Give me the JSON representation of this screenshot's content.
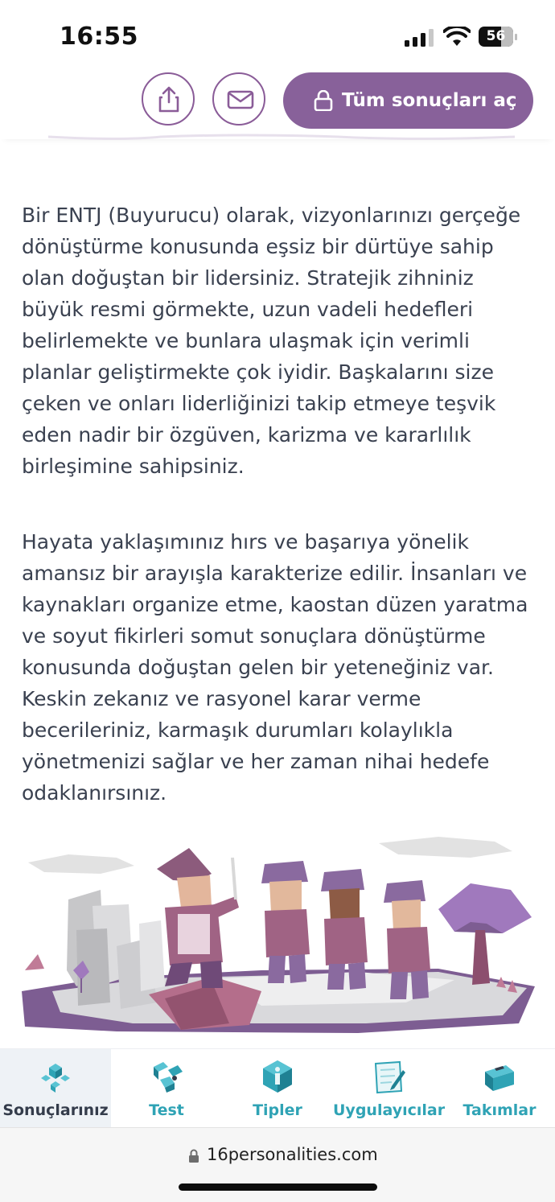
{
  "status": {
    "time": "16:55",
    "battery": "56"
  },
  "actions": {
    "share_icon": "share-icon",
    "mail_icon": "mail-icon",
    "unlock_label": "Tüm sonuçları aç"
  },
  "content": {
    "paragraphs": [
      "Bir ENTJ (Buyurucu) olarak, vizyonlarınızı gerçeğe dönüştürme konusunda eşsiz bir dürtüye sahip olan doğuştan bir lidersiniz. Stratejik zihniniz büyük resmi görmekte, uzun vadeli hedefleri belirlemekte ve bunlara ulaşmak için verimli planlar geliştirmekte çok iyidir. Başkalarını size çeken ve onları liderliğinizi takip etmeye teşvik eden nadir bir özgüven, karizma ve kararlılık birleşimine sahipsiniz.",
      "Hayata yaklaşımınız hırs ve başarıya yönelik amansız bir arayışla karakterize edilir. İnsanları ve kaynakları organize etme, kaostan düzen yaratma ve soyut fikirleri somut sonuçlara dönüştürme konusunda doğuştan gelen bir yeteneğiniz var. Keskin zekanız ve rasyonel karar verme becerileriniz, karmaşık durumları kolaylıkla yönetmenizi sağlar ve her zaman nihai hedefe odaklanırsınız."
    ]
  },
  "nav": {
    "items": [
      {
        "label": "Sonuçlarınız",
        "icon": "results-icon",
        "active": true
      },
      {
        "label": "Test",
        "icon": "test-icon",
        "active": false
      },
      {
        "label": "Tipler",
        "icon": "types-icon",
        "active": false
      },
      {
        "label": "Uygulayıcılar",
        "icon": "practitioners-icon",
        "active": false
      },
      {
        "label": "Takımlar",
        "icon": "teams-icon",
        "active": false
      }
    ]
  },
  "browser": {
    "url": "16personalities.com"
  },
  "colors": {
    "brand_purple": "#88619a",
    "nav_teal": "#2fa3b5",
    "text": "#3a4150"
  }
}
